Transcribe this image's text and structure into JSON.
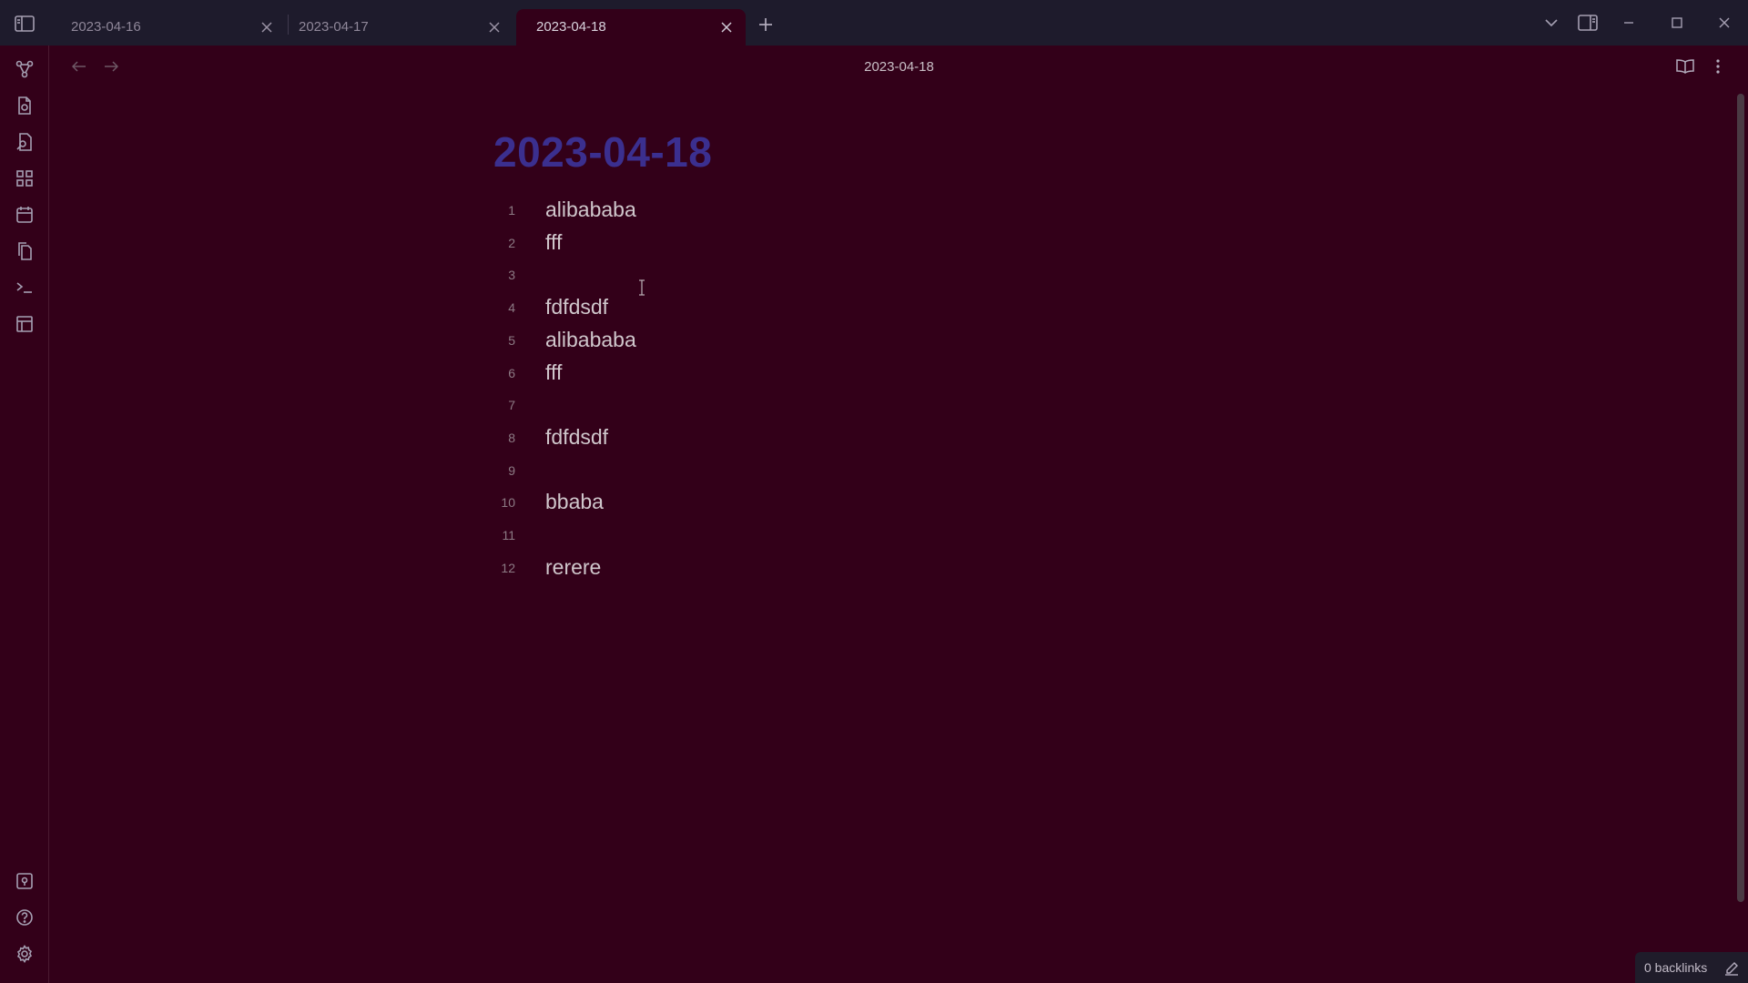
{
  "tabs": [
    {
      "label": "2023-04-16",
      "active": false
    },
    {
      "label": "2023-04-17",
      "active": false
    },
    {
      "label": "2023-04-18",
      "active": true
    }
  ],
  "view": {
    "title": "2023-04-18"
  },
  "document": {
    "title": "2023-04-18",
    "lines": [
      {
        "num": "1",
        "text": "alibababa"
      },
      {
        "num": "2",
        "text": "fff"
      },
      {
        "num": "3",
        "text": ""
      },
      {
        "num": "4",
        "text": "fdfdsdf"
      },
      {
        "num": "5",
        "text": "alibababa"
      },
      {
        "num": "6",
        "text": "fff"
      },
      {
        "num": "7",
        "text": ""
      },
      {
        "num": "8",
        "text": "fdfdsdf"
      },
      {
        "num": "9",
        "text": ""
      },
      {
        "num": "10",
        "text": "bbaba"
      },
      {
        "num": "11",
        "text": ""
      },
      {
        "num": "12",
        "text": "rerere"
      }
    ]
  },
  "status": {
    "backlinks": "0 backlinks"
  },
  "colors": {
    "background": "#330019",
    "titlebar": "#1e1b2c",
    "title_accent": "#3b2f8f"
  },
  "icons": {
    "ribbon_top": [
      "graph-view-icon",
      "daily-note-icon",
      "search-note-icon",
      "canvas-icon",
      "calendar-icon",
      "templates-icon",
      "command-palette-icon",
      "layout-icon"
    ],
    "ribbon_bottom": [
      "vault-icon",
      "help-icon",
      "settings-icon"
    ]
  }
}
